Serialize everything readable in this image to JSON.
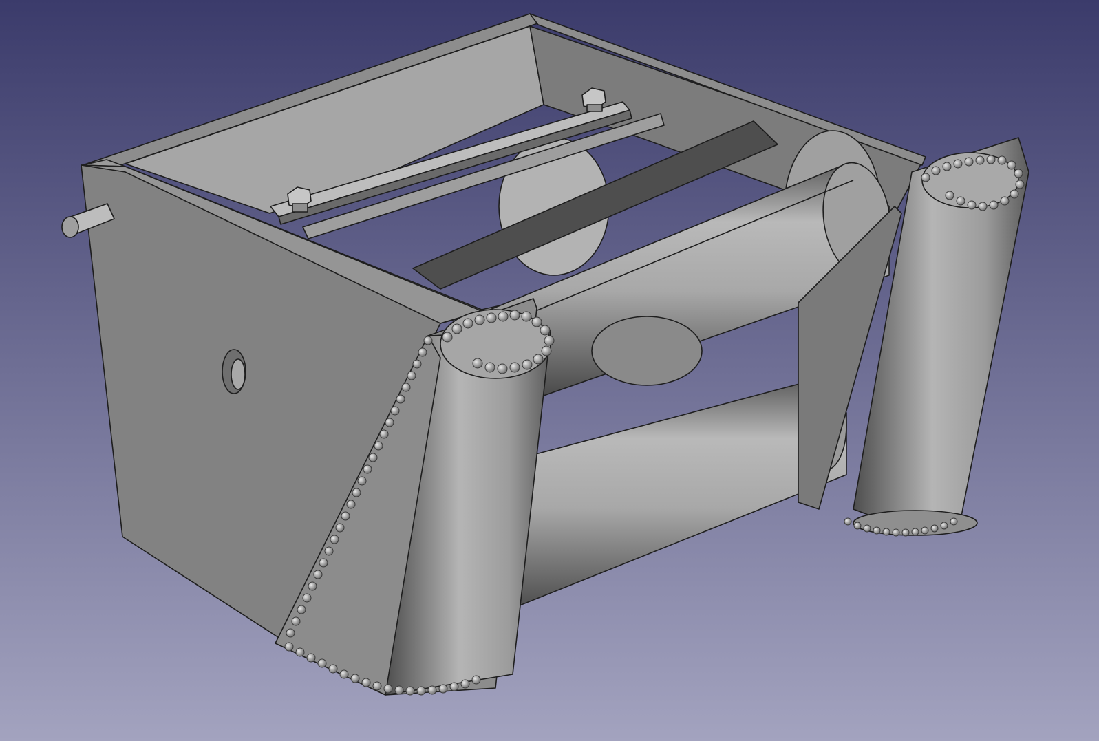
{
  "viewport": {
    "background_top": "#3b3b6b",
    "background_bottom": "#a3a3bf",
    "model_fill": "#8a8a8a",
    "edge_color": "#1e1e1e"
  },
  "model": {
    "description_icon": "cad-3d-model",
    "parts": [
      "box-housing",
      "left-side-plate",
      "shaft-pin",
      "mount-hole",
      "top-clamp-bar",
      "hex-bolt-left",
      "hex-bolt-right",
      "inner-drum",
      "upper-roller",
      "lower-roller",
      "left-vertical-roller",
      "right-vertical-roller",
      "weld-beads"
    ]
  }
}
